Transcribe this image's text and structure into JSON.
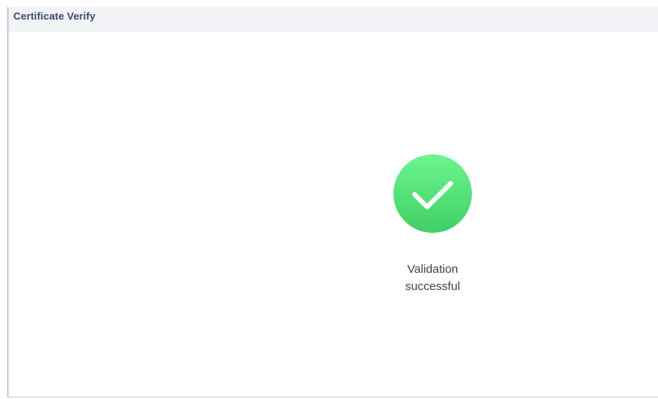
{
  "window": {
    "title": "Certificate Verify"
  },
  "result": {
    "icon": "check-circle-icon",
    "status_color": "#4cd670",
    "message_line1": "Validation",
    "message_line2": "successful"
  }
}
